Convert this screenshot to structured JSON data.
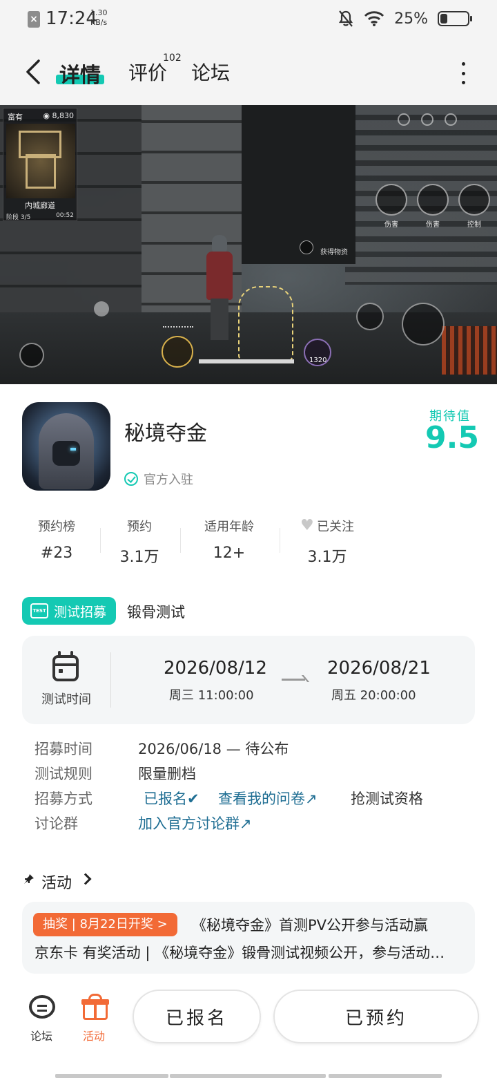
{
  "status_bar": {
    "time": "17:24",
    "speed_value": "1.30",
    "speed_unit": "KB/s",
    "battery": "25%",
    "battery_level": 0.25
  },
  "header": {
    "tabs": [
      {
        "label": "详情",
        "active": true
      },
      {
        "label": "评价",
        "badge": "102"
      },
      {
        "label": "论坛"
      }
    ]
  },
  "screenshot": {
    "minimap_title": "富有",
    "coins": "8,830",
    "location": "内城廊道",
    "stage": "阶段 3/5",
    "timer": "00:52",
    "skill_labels": [
      "伤害",
      "伤害",
      "控制"
    ],
    "loot_text": "获得物资",
    "item_count": "1320"
  },
  "app": {
    "name": "秘境夺金",
    "official_label": "官方入驻",
    "expect_label": "期待值",
    "expect_value": "9.5"
  },
  "stats": [
    {
      "label": "预约榜",
      "value": "#23"
    },
    {
      "label": "预约",
      "value": "3.1万"
    },
    {
      "label": "适用年龄",
      "value": "12+"
    },
    {
      "label": "已关注",
      "value": "3.1万"
    }
  ],
  "test": {
    "badge_icon_text": "TEST",
    "badge_label": "测试招募",
    "name": "锻骨测试",
    "time_label": "测试时间",
    "start_date": "2026/08/12",
    "start_time": "周三  11:00:00",
    "end_date": "2026/08/21",
    "end_time": "周五  20:00:00"
  },
  "info_rows": {
    "recruit_time_label": "招募时间",
    "recruit_time_value": "2026/06/18 — 待公布",
    "rule_label": "测试规则",
    "rule_value": "限量删档",
    "method_label": "招募方式",
    "method_registered": "已报名✔",
    "method_survey": "查看我的问卷↗",
    "method_grab": "抢测试资格",
    "group_label": "讨论群",
    "group_link": "加入官方讨论群↗"
  },
  "activity": {
    "title": "活动",
    "lottery_badge": "抽奖 | 8月22日开奖 >",
    "line1": "《秘境夺金》首测PV公开参与活动赢",
    "line2": "京东卡 有奖活动 | 《秘境夺金》锻骨测试视频公开，参与活动赢京东卡"
  },
  "bottom_bar": {
    "forum_label": "论坛",
    "activity_label": "活动",
    "registered_button": "已报名",
    "reserved_button": "已预约"
  },
  "colors": {
    "accent": "#14c9b3",
    "lottery": "#f26a36",
    "link": "#1f6e93"
  }
}
